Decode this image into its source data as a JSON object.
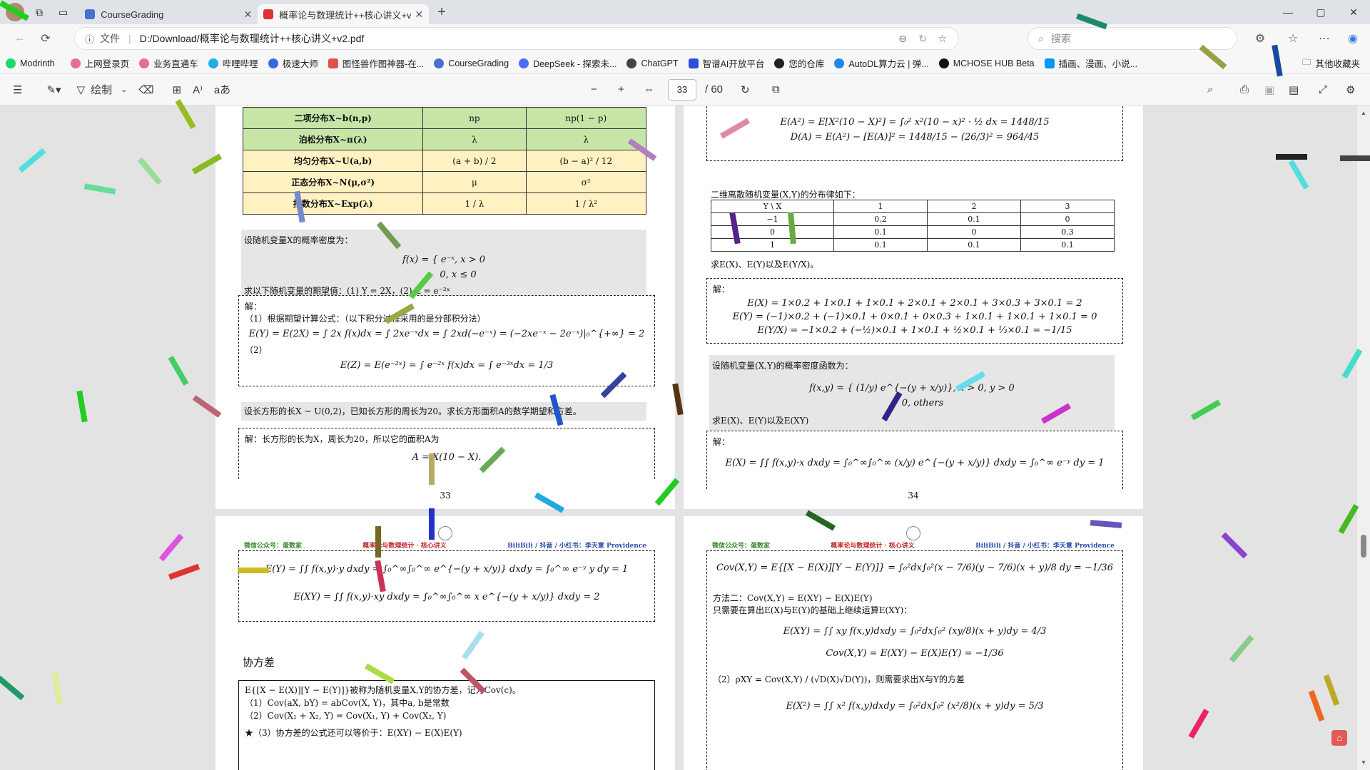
{
  "tabs": [
    {
      "label": "CourseGrading",
      "active": false
    },
    {
      "label": "概率论与数理统计++核心讲义+v...",
      "active": true
    }
  ],
  "window": {
    "minimize": "—",
    "maximize": "▢",
    "close": "✕"
  },
  "address": {
    "protocol_label": "文件",
    "url": "D:/Download/概率论与数理统计++核心讲义+v2.pdf",
    "search_placeholder": "搜索"
  },
  "favorites": [
    "Modrinth",
    "上网登录页",
    "业务直通车",
    "哔哩哔哩",
    "极速大师",
    "图怪兽作图神器-在...",
    "CourseGrading",
    "DeepSeek - 探索未...",
    "ChatGPT",
    "智谱AI开放平台",
    "您的仓库",
    "AutoDL算力云 | 弹...",
    "MCHOSE HUB Beta",
    "插画、漫画、小说..."
  ],
  "favorites_other": "其他收藏夹",
  "pdf_toolbar": {
    "draw_label": "绘制",
    "page_current": "33",
    "page_total": "/ 60",
    "aa": "aあ"
  },
  "page33": {
    "rows": [
      {
        "name": "二项分布X~b(n,p)",
        "e": "np",
        "d": "np(1 − p)",
        "c": "g"
      },
      {
        "name": "泊松分布X~π(λ)",
        "e": "λ",
        "d": "λ",
        "c": "g"
      },
      {
        "name": "均匀分布X~U(a,b)",
        "e": "(a + b) / 2",
        "d": "(b − a)² / 12",
        "c": "y"
      },
      {
        "name": "正态分布X~N(μ,σ²)",
        "e": "μ",
        "d": "σ²",
        "c": "y"
      },
      {
        "name": "指数分布X~Exp(λ)",
        "e": "1 / λ",
        "d": "1 / λ²",
        "c": "y"
      }
    ],
    "q1": "设随机变量X的概率密度为：",
    "q1_f1": "f(x) = { e⁻ˣ,  x > 0",
    "q1_f2": "0,  x ≤ 0",
    "q1_ask": "求以下随机变量的期望值：(1) Y = 2X，(2) Z = e⁻²ˣ",
    "sol": "解：",
    "s1": "（1）根据期望计算公式：（以下积分过程采用的是分部积分法）",
    "s1_f": "E(Y) = E(2X) = ∫ 2x f(x)dx = ∫ 2xe⁻ˣdx = ∫ 2xd(−e⁻ˣ) = (−2xe⁻ˣ − 2e⁻ˣ)|₀^{+∞} = 2",
    "s2": "（2）",
    "s2_f": "E(Z) = E(e⁻²ˣ) = ∫ e⁻²ˣ f(x)dx = ∫ e⁻³ˣdx = 1/3",
    "q2": "设长方形的长X ~ U(0,2)，已知长方形的周长为20。求长方形面积A的数学期望和方差。",
    "q2_sol": "解：长方形的长为X，周长为20，所以它的面积A为",
    "q2_f": "A = X(10 − X).",
    "num": "33"
  },
  "page34": {
    "top_f1": "E(A²) = E[X²(10 − X)²] = ∫₀² x²(10 − x)² · ½ dx = 1448/15",
    "top_f2": "D(A) = E(A²) − [E(A)]² = 1448/15 − (26/3)² = 964/45",
    "q": "二维离散随机变量(X,Y)的分布律如下：",
    "table_head": [
      "Y \\ X",
      "1",
      "2",
      "3"
    ],
    "table_rows": [
      [
        "−1",
        "0.2",
        "0.1",
        "0"
      ],
      [
        "0",
        "0.1",
        "0",
        "0.3"
      ],
      [
        "1",
        "0.1",
        "0.1",
        "0.1"
      ]
    ],
    "ask": "求E(X)、E(Y)以及E(Y/X)。",
    "sol": "解：",
    "f1": "E(X) = 1×0.2 + 1×0.1 + 1×0.1 + 2×0.1 + 2×0.1 + 3×0.3 + 3×0.1 = 2",
    "f2": "E(Y) = (−1)×0.2 + (−1)×0.1 + 0×0.1 + 0×0.3 + 1×0.1 + 1×0.1 + 1×0.1 = 0",
    "f3": "E(Y/X) = −1×0.2 + (−½)×0.1 + 1×0.1 + ½×0.1 + ⅓×0.1 = −1/15",
    "q2": "设随机变量(X,Y)的概率密度函数为：",
    "q2_f1": "f(x,y) = { (1/y) e^{−(y + x/y)},  x > 0, y > 0",
    "q2_f2": "0,  others",
    "q2_ask": "求E(X)、E(Y)以及E(XY)",
    "sol2": "解：",
    "s_f": "E(X) = ∫∫ f(x,y)·x dxdy = ∫₀^∞∫₀^∞ (x/y) e^{−(y + x/y)} dxdy = ∫₀^∞ e⁻ʸ dy = 1",
    "num": "34"
  },
  "page35": {
    "h_left": "微信公众号：蛋数家",
    "h_mid": "概率论与数理统计 · 核心讲义",
    "h_right": "BiliBili / 抖音 / 小红书：李天意 Providence",
    "f1": "E(Y) = ∫∫ f(x,y)·y dxdy = ∫₀^∞∫₀^∞ e^{−(y + x/y)} dxdy = ∫₀^∞ e⁻ʸ y dy = 1",
    "f2": "E(XY) = ∫∫ f(x,y)·xy dxdy = ∫₀^∞∫₀^∞ x e^{−(y + x/y)} dxdy = 2",
    "title": "协方差",
    "b1": "E{[X − E(X)][Y − E(Y)]}被称为随机变量X,Y的协方差，记为Cov(c)。",
    "b2": "（1）Cov(aX, bY) = abCov(X, Y)，其中a, b是常数",
    "b3": "（2）Cov(X₁ + X₂, Y) = Cov(X₁, Y) + Cov(X₂, Y)",
    "b4": "★（3）协方差的公式还可以等价于：E(XY) − E(X)E(Y)"
  },
  "page36": {
    "h_left": "微信公众号：蛋数家",
    "h_mid": "概率论与数理统计 · 核心讲义",
    "h_right": "BiliBili / 抖音 / 小红书：李天意 Providence",
    "f1": "Cov(X,Y) = E{[X − E(X)][Y − E(Y)]} = ∫₀²dx∫₀²(x − 7/6)(y − 7/6)(x + y)/8 dy = −1/36",
    "m2": "方法二：Cov(X,Y) = E(XY) − E(X)E(Y)",
    "m2b": "只需要在算出E(X)与E(Y)的基础上继续运算E(XY)：",
    "f2": "E(XY) = ∫∫ xy f(x,y)dxdy = ∫₀²dx∫₀² (xy/8)(x + y)dy = 4/3",
    "f3": "Cov(X,Y) = E(XY) − E(X)E(Y) = −1/36",
    "f4": "（2）ρXY = Cov(X,Y) / (√D(X)√D(Y))，则需要求出X与Y的方差",
    "f5": "E(X²) = ∫∫ x² f(x,y)dxdy = ∫₀²dx∫₀² (x²/8)(x + y)dy = 5/3"
  }
}
